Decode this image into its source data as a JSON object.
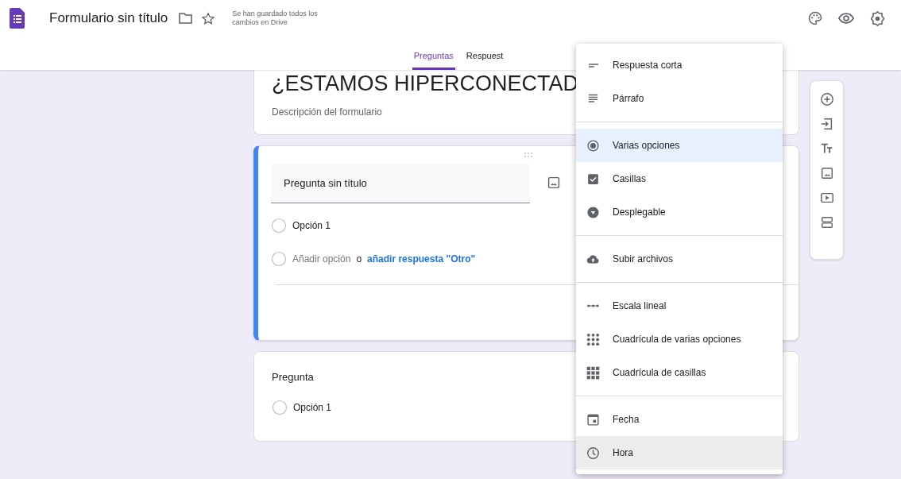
{
  "header": {
    "title": "Formulario sin título",
    "save_status": "Se han guardado todos los cambios en Drive"
  },
  "tabs": [
    {
      "label": "Preguntas",
      "selected": true
    },
    {
      "label": "Respuest",
      "selected": false
    }
  ],
  "form": {
    "title": "¿ESTAMOS HIPERCONECTAD",
    "description": "Descripción del formulario"
  },
  "questions": [
    {
      "kind": "editing",
      "title": "Pregunta sin título",
      "options": [
        "Opción 1"
      ],
      "add_option": "Añadir opción",
      "or": "o",
      "add_other": "añadir respuesta \"Otro\""
    },
    {
      "kind": "preview",
      "title": "Pregunta",
      "options": [
        "Opción 1"
      ]
    }
  ],
  "type_menu": {
    "groups": [
      [
        {
          "kind": "short",
          "label": "Respuesta corta",
          "selected": false,
          "hovered": false
        },
        {
          "kind": "paragraph",
          "label": "Párrafo",
          "selected": false,
          "hovered": false
        }
      ],
      [
        {
          "kind": "radio",
          "label": "Varias opciones",
          "selected": true,
          "hovered": false
        },
        {
          "kind": "checkbox",
          "label": "Casillas",
          "selected": false,
          "hovered": false
        },
        {
          "kind": "dropdown",
          "label": "Desplegable",
          "selected": false,
          "hovered": false
        }
      ],
      [
        {
          "kind": "upload",
          "label": "Subir archivos",
          "selected": false,
          "hovered": false
        }
      ],
      [
        {
          "kind": "scale",
          "label": "Escala lineal",
          "selected": false,
          "hovered": false
        },
        {
          "kind": "radio_grid",
          "label": "Cuadrícula de varias opciones",
          "selected": false,
          "hovered": false
        },
        {
          "kind": "check_grid",
          "label": "Cuadrícula de casillas",
          "selected": false,
          "hovered": false
        }
      ],
      [
        {
          "kind": "date",
          "label": "Fecha",
          "selected": false,
          "hovered": false
        },
        {
          "kind": "time",
          "label": "Hora",
          "selected": false,
          "hovered": true
        }
      ]
    ]
  }
}
